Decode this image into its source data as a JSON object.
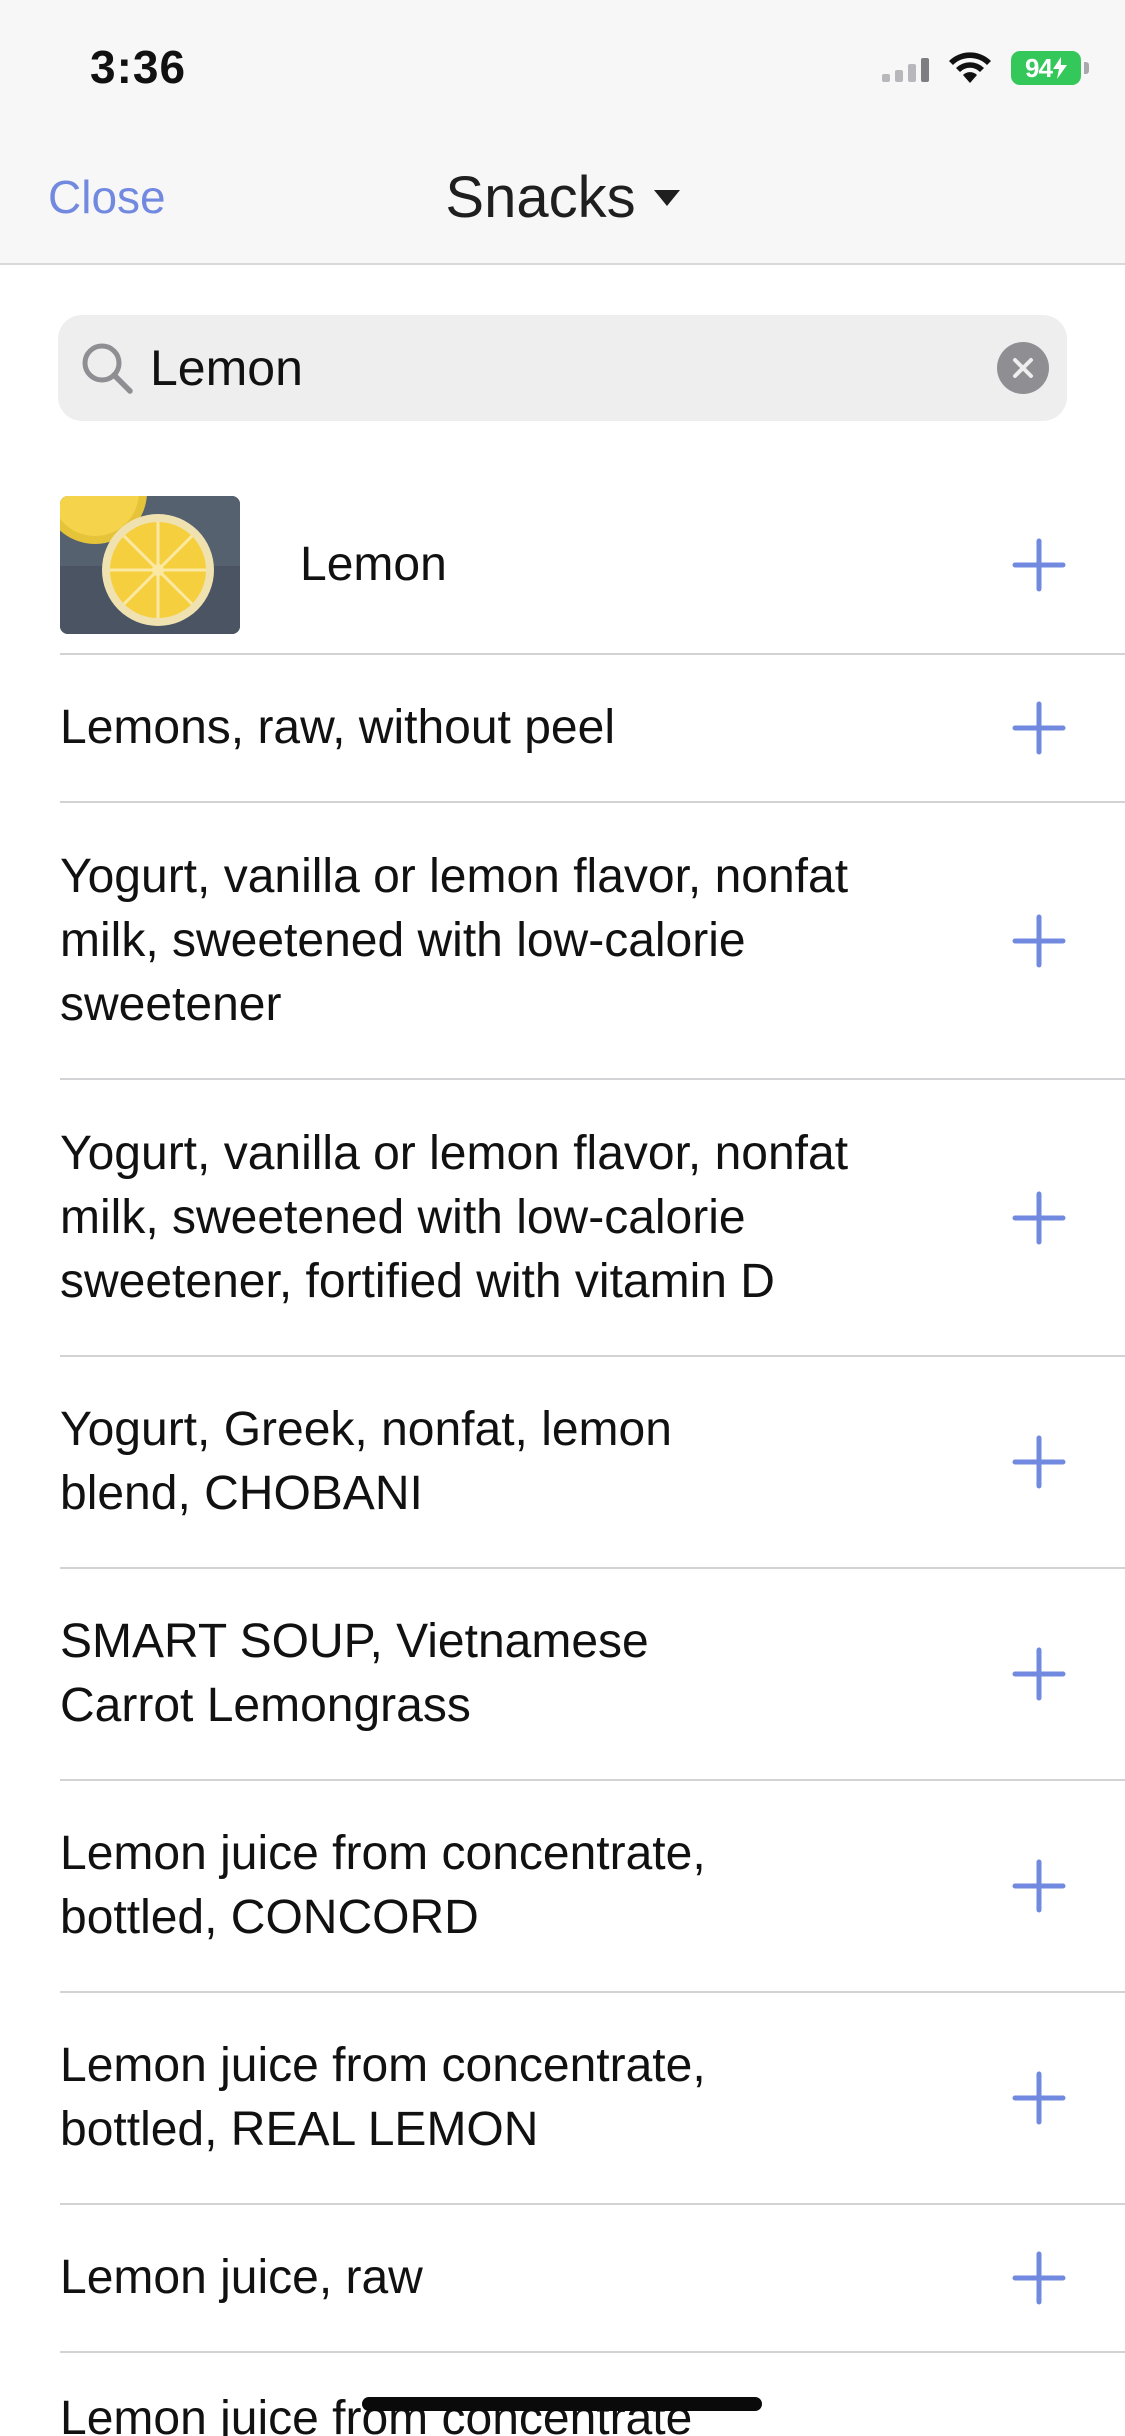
{
  "status": {
    "time": "3:36",
    "battery": "94"
  },
  "nav": {
    "close_label": "Close",
    "title": "Snacks"
  },
  "search": {
    "value": "Lemon",
    "placeholder": "Search"
  },
  "results": [
    {
      "label": "Lemon",
      "has_image": true
    },
    {
      "label": "Lemons, raw, without peel"
    },
    {
      "label": "Yogurt, vanilla or lemon flavor, nonfat milk, sweetened with low-calorie sweetener"
    },
    {
      "label": "Yogurt, vanilla or lemon flavor, nonfat milk, sweetened with low-calorie sweetener, fortified with vitamin D"
    },
    {
      "label": "Yogurt, Greek, nonfat, lemon blend, CHOBANI"
    },
    {
      "label": "SMART SOUP, Vietnamese Carrot Lemongrass"
    },
    {
      "label": "Lemon juice from concentrate, bottled, CONCORD"
    },
    {
      "label": "Lemon juice from concentrate, bottled, REAL LEMON"
    },
    {
      "label": "Lemon juice, raw"
    },
    {
      "label": "Lemon juice from concentrate"
    }
  ],
  "icons": {
    "add": "plus-icon",
    "search": "search-icon",
    "clear": "clear-icon",
    "caret": "caret-down-icon"
  },
  "colors": {
    "accent": "#7289e0",
    "battery": "#34c759"
  }
}
